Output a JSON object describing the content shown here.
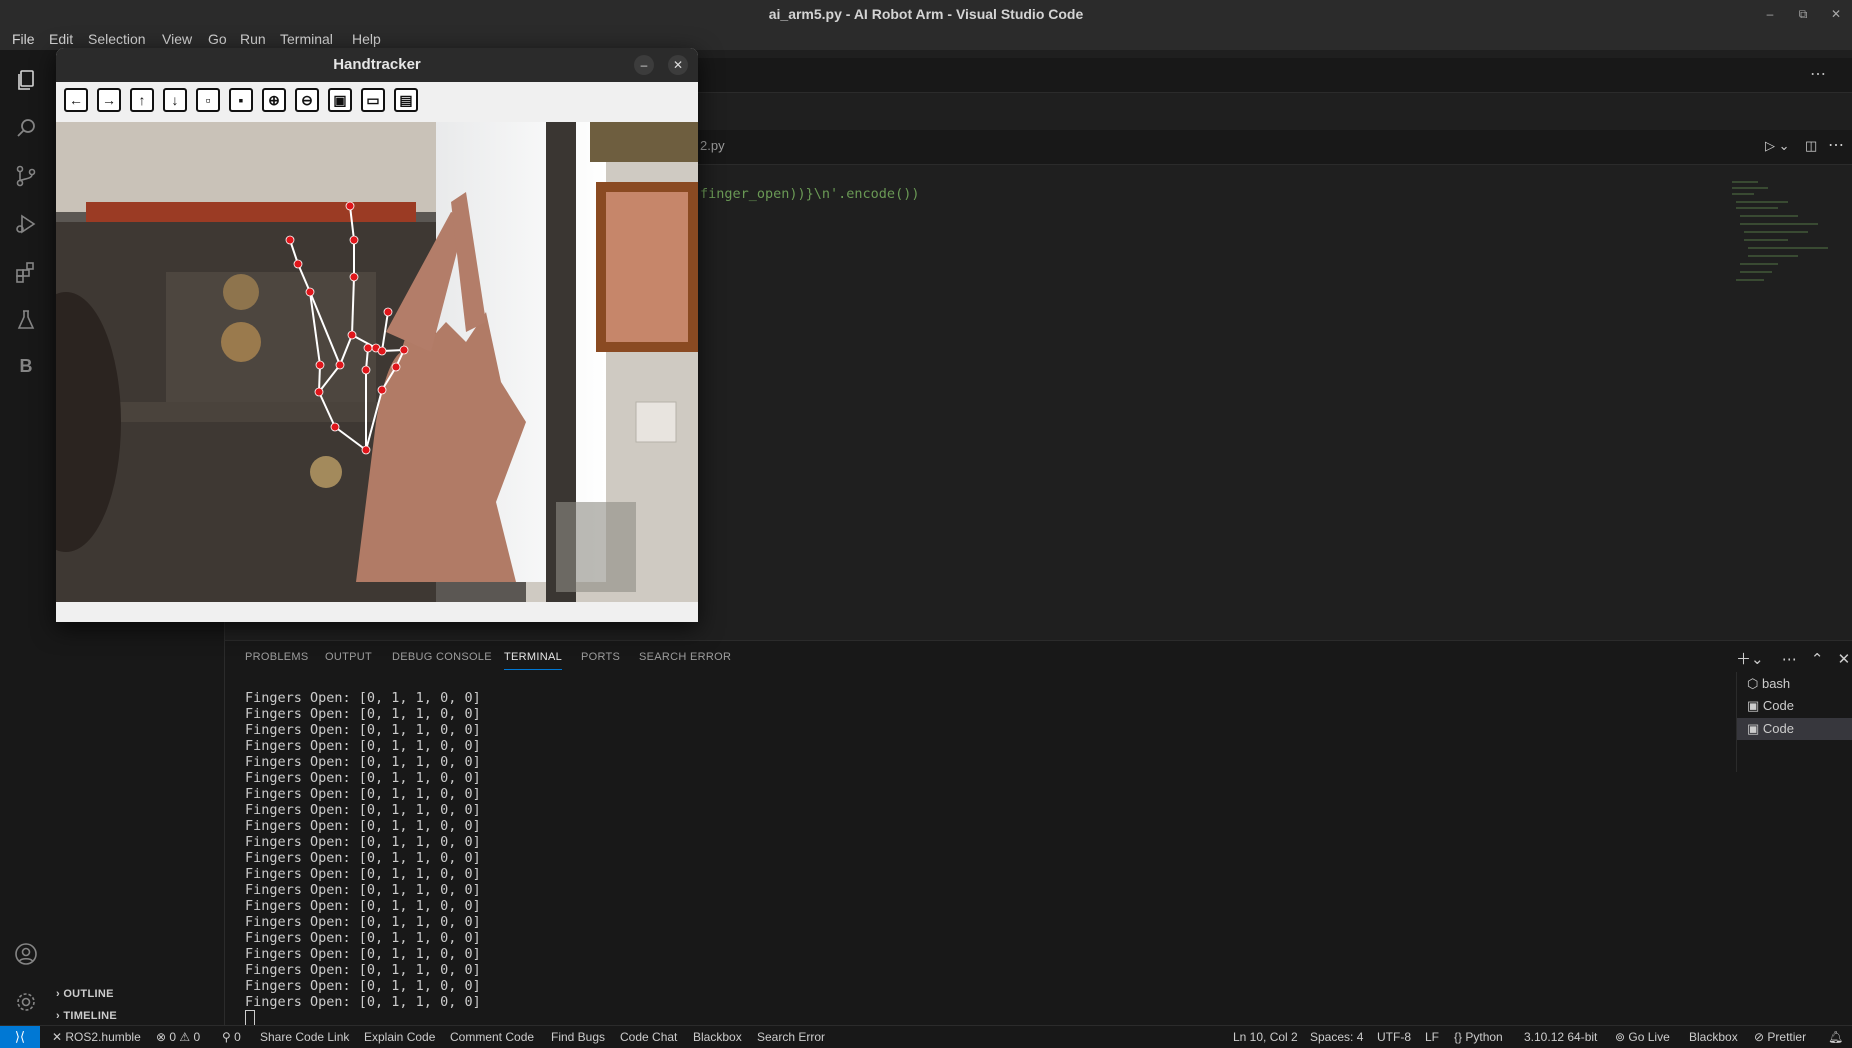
{
  "window": {
    "title": "ai_arm5.py - AI Robot Arm - Visual Studio Code"
  },
  "menu": [
    "File",
    "Edit",
    "Selection",
    "View",
    "Go",
    "Run",
    "Terminal",
    "Help"
  ],
  "activity_icons": [
    "explorer-icon",
    "search-icon",
    "source-control-icon",
    "run-debug-icon",
    "extensions-icon",
    "testing-icon",
    "blackbox-icon",
    "account-icon",
    "settings-icon"
  ],
  "activity_blackbox_letter": "B",
  "sidebar": {
    "outline": "OUTLINE",
    "timeline": "TIMELINE"
  },
  "editor": {
    "tab_label": "2.py",
    "code_line": "finger_open))}\\n'.encode())"
  },
  "panel": {
    "tabs": [
      "PROBLEMS",
      "OUTPUT",
      "DEBUG CONSOLE",
      "TERMINAL",
      "PORTS",
      "SEARCH ERROR"
    ],
    "active_tab": "TERMINAL",
    "terminal_line": "Fingers Open: [0, 1, 1, 0, 0]",
    "terminal_line_count": 20,
    "terminals": [
      "bash",
      "Code",
      "Code"
    ]
  },
  "statusbar": {
    "remote": "ROS2.humble",
    "problems": "0",
    "warnings": "0",
    "ports": "0",
    "items_left": [
      "Share Code Link",
      "Explain Code",
      "Comment Code",
      "Find Bugs",
      "Code Chat",
      "Blackbox",
      "Search Error"
    ],
    "position": "Ln 10, Col 2",
    "spaces": "Spaces: 4",
    "encoding": "UTF-8",
    "eol": "LF",
    "language": "Python",
    "interpreter": "3.10.12 64-bit",
    "golive": "Go Live",
    "blackbox": "Blackbox",
    "prettier": "Prettier"
  },
  "handtracker": {
    "title": "Handtracker",
    "toolbar": [
      "back-arrow-icon",
      "forward-arrow-icon",
      "up-arrow-icon",
      "down-arrow-icon",
      "image-icon",
      "image-stack-icon",
      "zoom-in-icon",
      "zoom-out-icon",
      "save-icon",
      "copy-icon",
      "properties-icon"
    ]
  },
  "colors": {
    "accent": "#0078d4",
    "landmark": "#e0161b",
    "skeleton": "#ffffff"
  }
}
